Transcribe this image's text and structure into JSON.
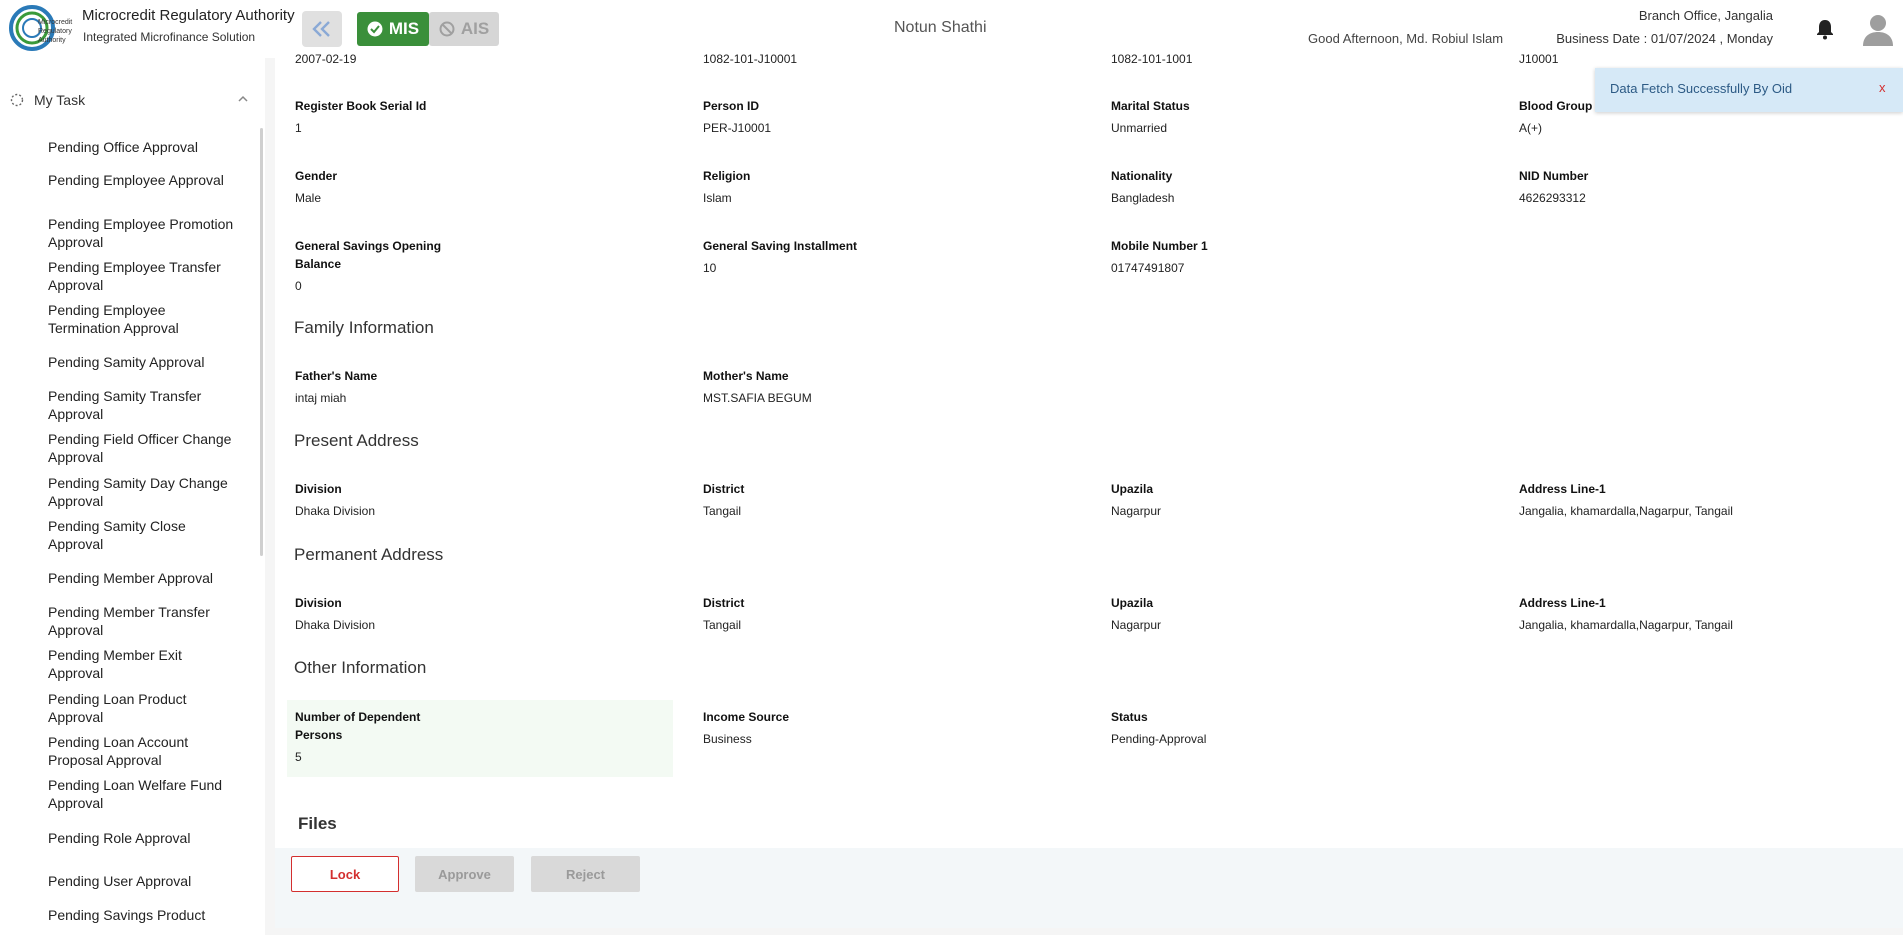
{
  "header": {
    "app_title": "Microcredit Regulatory Authority",
    "app_subtitle": "Integrated Microfinance Solution",
    "logo_text": "Microcredit Regulatory Authority",
    "mis_label": "MIS",
    "ais_label": "AIS",
    "center_title": "Notun Shathi",
    "greeting": "Good Afternoon, Md. Robiul Islam",
    "branch": "Branch Office, Jangalia",
    "business_date": "Business Date : 01/07/2024 , Monday",
    "accent_color": "#3a8f3a"
  },
  "sidebar": {
    "my_task": "My Task",
    "items": [
      "Pending Office Approval",
      "Pending Employee Approval",
      "Pending Employee Promotion Approval",
      "Pending Employee Transfer Approval",
      "Pending Employee Termination Approval",
      "Pending Samity Approval",
      "Pending Samity Transfer Approval",
      "Pending Field Officer Change Approval",
      "Pending Samity Day Change Approval",
      "Pending Samity Close Approval",
      "Pending Member Approval",
      "Pending Member Transfer Approval",
      "Pending Member Exit Approval",
      "Pending Loan Product Approval",
      "Pending Loan Account Proposal Approval",
      "Pending Loan Welfare Fund Approval",
      "Pending Role Approval",
      "Pending User Approval",
      "Pending Savings Product"
    ]
  },
  "top_partial": {
    "v1": "2007-02-19",
    "v2": "1082-101-J10001",
    "v3": "1082-101-1001",
    "v4": "J10001"
  },
  "personal": {
    "register_book_serial_id": {
      "label": "Register Book Serial Id",
      "value": "1"
    },
    "person_id": {
      "label": "Person ID",
      "value": "PER-J10001"
    },
    "marital_status": {
      "label": "Marital Status",
      "value": "Unmarried"
    },
    "blood_group": {
      "label": "Blood Group",
      "value": "A(+)"
    },
    "gender": {
      "label": "Gender",
      "value": "Male"
    },
    "religion": {
      "label": "Religion",
      "value": "Islam"
    },
    "nationality": {
      "label": "Nationality",
      "value": "Bangladesh"
    },
    "nid_number": {
      "label": "NID Number",
      "value": "4626293312"
    },
    "gs_opening_balance": {
      "label_1": "General Savings Opening",
      "label_2": "Balance",
      "value": "0"
    },
    "gs_installment": {
      "label": "General Saving Installment",
      "value": "10"
    },
    "mobile_1": {
      "label": "Mobile Number 1",
      "value": "01747491807"
    }
  },
  "family": {
    "title": "Family Information",
    "father": {
      "label": "Father's Name",
      "value": "intaj miah"
    },
    "mother": {
      "label": "Mother's Name",
      "value": "MST.SAFIA BEGUM"
    }
  },
  "present_address": {
    "title": "Present Address",
    "division": {
      "label": "Division",
      "value": "Dhaka Division"
    },
    "district": {
      "label": "District",
      "value": "Tangail"
    },
    "upazila": {
      "label": "Upazila",
      "value": "Nagarpur"
    },
    "address_line_1": {
      "label": "Address Line-1",
      "value": "Jangalia, khamardalla,Nagarpur, Tangail"
    }
  },
  "permanent_address": {
    "title": "Permanent Address",
    "division": {
      "label": "Division",
      "value": "Dhaka Division"
    },
    "district": {
      "label": "District",
      "value": "Tangail"
    },
    "upazila": {
      "label": "Upazila",
      "value": "Nagarpur"
    },
    "address_line_1": {
      "label": "Address Line-1",
      "value": "Jangalia, khamardalla,Nagarpur, Tangail"
    }
  },
  "other": {
    "title": "Other Information",
    "dependents": {
      "label_1": "Number of Dependent",
      "label_2": "Persons",
      "value": "5"
    },
    "income_source": {
      "label": "Income Source",
      "value": "Business"
    },
    "status": {
      "label": "Status",
      "value": "Pending-Approval"
    }
  },
  "files": {
    "title": "Files"
  },
  "actions": {
    "lock": "Lock",
    "approve": "Approve",
    "reject": "Reject"
  },
  "toast": {
    "message": "Data Fetch Successfully By Oid",
    "close": "x"
  }
}
